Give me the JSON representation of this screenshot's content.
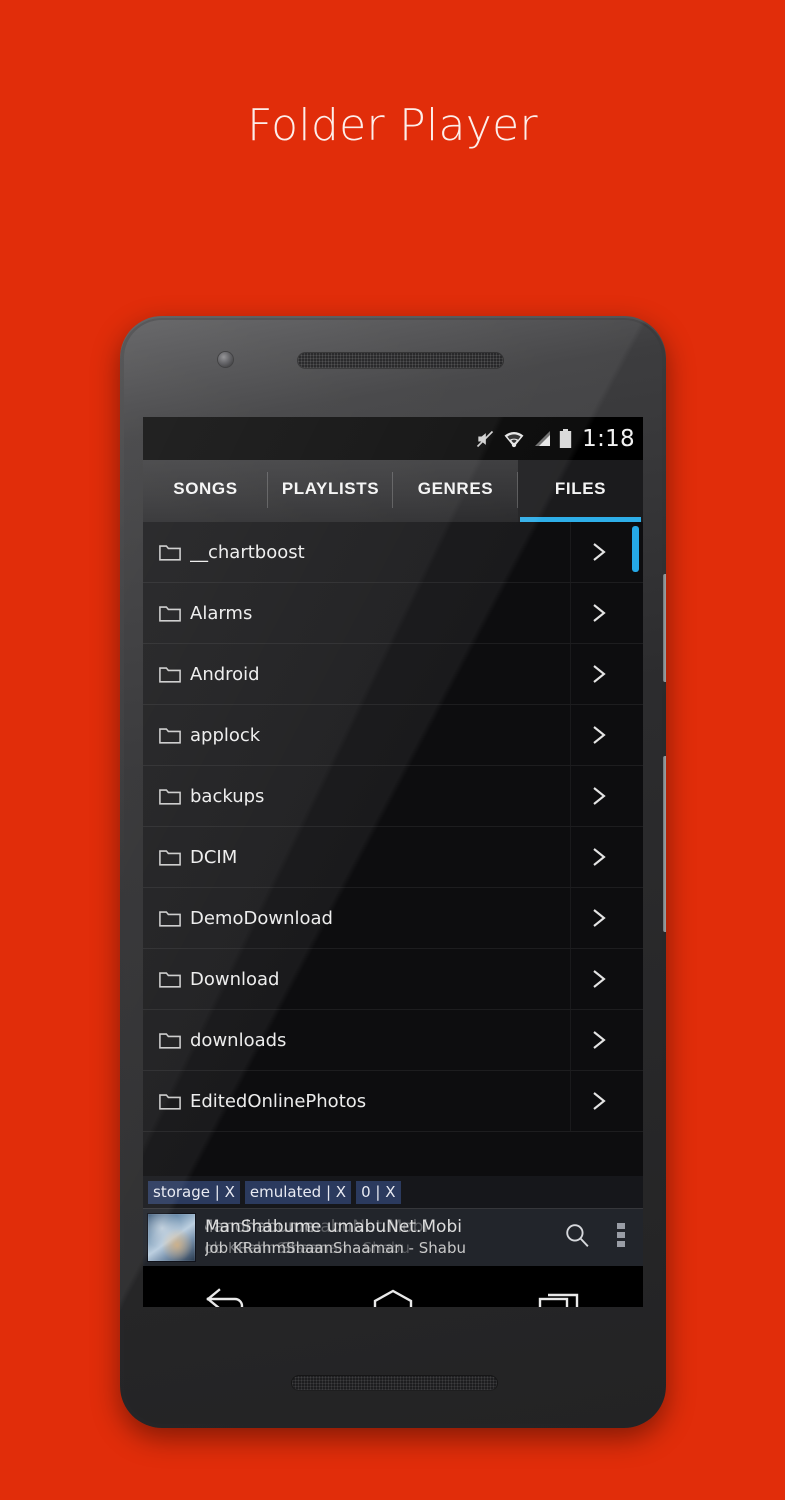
{
  "promo": {
    "title": "Folder Player",
    "background_color": "#e12d0a"
  },
  "statusbar": {
    "icons": [
      "mute-icon",
      "wifi-icon",
      "signal-icon",
      "battery-icon"
    ],
    "time": "1:18"
  },
  "tabs": [
    {
      "label": "SONGS",
      "active": false
    },
    {
      "label": "PLAYLISTS",
      "active": false
    },
    {
      "label": "GENRES",
      "active": false
    },
    {
      "label": "FILES",
      "active": true
    }
  ],
  "accent_color": "#2eaee8",
  "files": [
    {
      "name": "__chartboost",
      "icon": "folder-icon",
      "chevron": "chevron-right-icon"
    },
    {
      "name": "Alarms",
      "icon": "folder-icon",
      "chevron": "chevron-right-icon"
    },
    {
      "name": "Android",
      "icon": "folder-icon",
      "chevron": "chevron-right-icon"
    },
    {
      "name": "applock",
      "icon": "folder-icon",
      "chevron": "chevron-right-icon"
    },
    {
      "name": "backups",
      "icon": "folder-icon",
      "chevron": "chevron-right-icon"
    },
    {
      "name": "DCIM",
      "icon": "folder-icon",
      "chevron": "chevron-right-icon"
    },
    {
      "name": "DemoDownload",
      "icon": "folder-icon",
      "chevron": "chevron-right-icon"
    },
    {
      "name": "Download",
      "icon": "folder-icon",
      "chevron": "chevron-right-icon"
    },
    {
      "name": "downloads",
      "icon": "folder-icon",
      "chevron": "chevron-right-icon"
    },
    {
      "name": "EditedOnlinePhotos",
      "icon": "folder-icon",
      "chevron": "chevron-right-icon"
    }
  ],
  "breadcrumbs": [
    {
      "label": "storage | X"
    },
    {
      "label": "emulated | X"
    },
    {
      "label": "0 | X"
    }
  ],
  "now_playing": {
    "album_art": "album-art-thumbnail",
    "title": "ManShabume umabuNet.Mobi",
    "title_ghost_a": "Manohabume",
    "title_ghost_b": "umabuNet.Mobi",
    "artist": "Job KRahmShaanShaaman - Shabu",
    "artist_ghost_a": "Job KRahmShaan",
    "artist_ghost_b": "Shaaman - Shabu",
    "search_label": "search-icon",
    "overflow_label": "overflow-menu-icon"
  },
  "navbar": [
    {
      "name": "back-button",
      "icon": "back-arrow-icon"
    },
    {
      "name": "home-button",
      "icon": "home-icon"
    },
    {
      "name": "recents-button",
      "icon": "recents-icon"
    }
  ]
}
